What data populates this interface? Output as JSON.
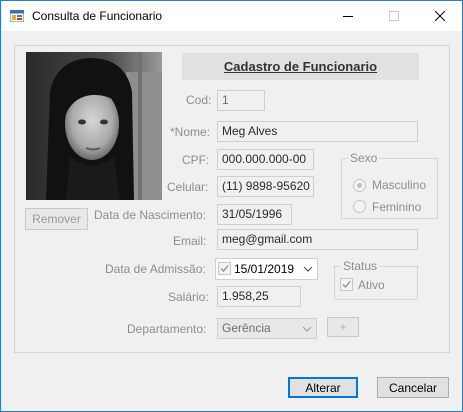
{
  "window": {
    "title": "Consulta de Funcionario"
  },
  "form": {
    "header": "Cadastro de Funcionario",
    "remove_button": "Remover",
    "cod": {
      "label": "Cod:",
      "value": "1"
    },
    "nome": {
      "label": "*Nome:",
      "value": "Meg Alves"
    },
    "cpf": {
      "label": "CPF:",
      "value": "000.000.000-00"
    },
    "celular": {
      "label": "Celular:",
      "value": "(11) 9898-95620"
    },
    "nascimento": {
      "label": "Data de Nascimento:",
      "value": "31/05/1996"
    },
    "email": {
      "label": "Email:",
      "value": "meg@gmail.com"
    },
    "admissao": {
      "label": "Data de Admissão:",
      "value": "15/01/2019",
      "checked": true
    },
    "salario": {
      "label": "Salário:",
      "value": "1.958,25"
    },
    "departamento": {
      "label": "Departamento:",
      "value": "Gerência",
      "add_label": "+"
    },
    "sexo": {
      "legend": "Sexo",
      "options": [
        "Masculino",
        "Feminino"
      ],
      "selected": "Masculino"
    },
    "status": {
      "legend": "Status",
      "option": "Ativo",
      "checked": true
    }
  },
  "buttons": {
    "alterar": "Alterar",
    "cancelar": "Cancelar"
  },
  "icons": {
    "app": "app-window-icon",
    "minimize": "minimize-icon",
    "maximize": "maximize-icon",
    "close": "close-icon"
  },
  "colors": {
    "accent": "#0078d7",
    "disabled_text": "#8d8d8d"
  }
}
